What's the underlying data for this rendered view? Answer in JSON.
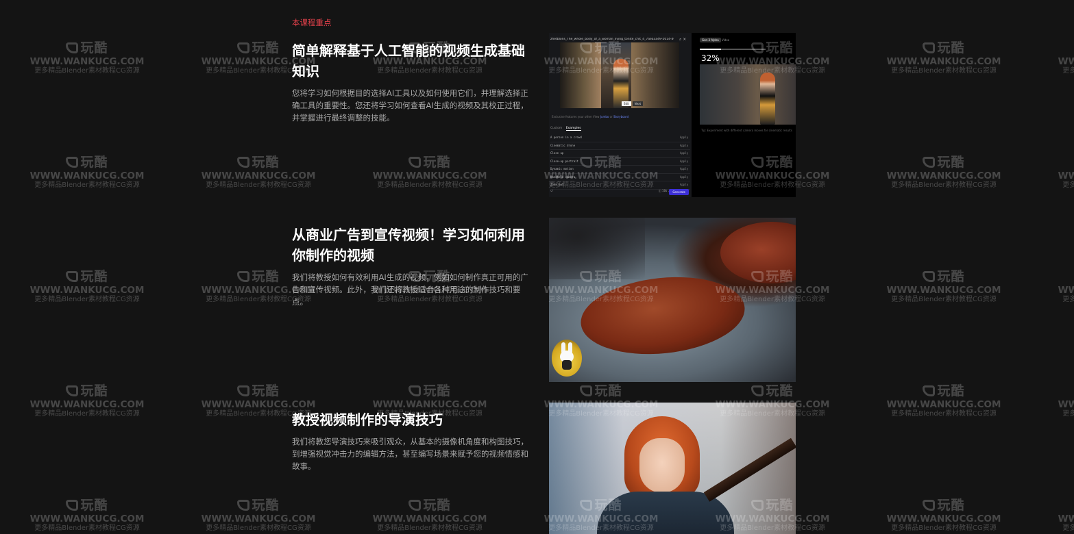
{
  "section_label": "本课程重点",
  "blocks": [
    {
      "title": "简单解释基于人工智能的视频生成基础知识",
      "description": "您将学习如何根据目的选择AI工具以及如何使用它们，并理解选择正确工具的重要性。您还将学习如何查看AI生成的视频及其校正过程，并掌握进行最终调整的技能。"
    },
    {
      "title": "从商业广告到宣传视频！学习如何利用你制作的视频",
      "description": "我们将教授如何有效利用AI生成的视频，例如如何制作真正可用的广告和宣传视频。此外，我们还将教授适合各种用途的制作技巧和要点。"
    },
    {
      "title": "教授视频制作的导演技巧",
      "description": "我们将教您导演技巧来吸引观众，从基本的摄像机角度和构图技巧，到增强视觉冲击力的编辑方法，甚至编写场景来赋予您的视频情感和故事。"
    }
  ],
  "ai_tool_ui": {
    "filename": "zhetblons_The_whole_body_of_a_woman_living_tonite_chit_4_7aea3a49-5014-46ad-ac5e-3f1e432a4ec_1.png",
    "caption_prefix": "Exclusive features your other View",
    "caption_link_1": "Jumbo",
    "caption_mid": "or",
    "caption_link_2": "Storyboard",
    "video_btn_1": "Edit",
    "video_btn_2": "Next",
    "tabs": [
      "Custom",
      "Examples"
    ],
    "active_tab": "Examples",
    "rows": [
      "A person in a crowd",
      "Cinematic drone",
      "Close up",
      "Close-up portrait",
      "Dynamic motion",
      "Handheld camera",
      "Zoom out"
    ],
    "row_action": "Apply",
    "bottom_left": "↺",
    "bottom_mid": "◫ 10s ⌄",
    "generate_label": "Generate",
    "right_tabs": [
      "Gen-3 Alpha",
      "Video"
    ],
    "right_active_tab": "Gen-3 Alpha",
    "progress_percent": "32%",
    "progress_value": 0.32,
    "right_note": "Tip: Experiment with different camera moves for cinematic results"
  },
  "watermark": {
    "logo": "玩酷",
    "url": "WWW.WANKUCG.COM",
    "sub": "更多精品Blender素材教程CG资源"
  },
  "colors": {
    "background": "#141414",
    "accent_red": "#e0404a",
    "heading": "#ffffff",
    "body_text": "#a8a8a8",
    "generate_button": "#3c2fd6"
  }
}
